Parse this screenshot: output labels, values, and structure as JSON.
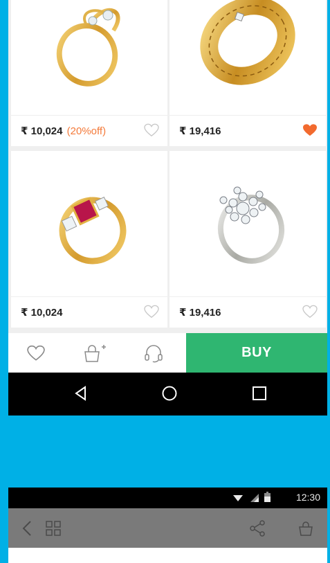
{
  "products": [
    {
      "price": "₹ 10,024",
      "discount": "(20%off)",
      "favorited": false,
      "image": "gold-twisted-diamond-ring"
    },
    {
      "price": "₹ 19,416",
      "discount": "",
      "favorited": true,
      "image": "gold-filigree-band"
    },
    {
      "price": "₹ 10,024",
      "discount": "",
      "favorited": false,
      "image": "gold-ruby-diamond-ring"
    },
    {
      "price": "₹ 19,416",
      "discount": "",
      "favorited": false,
      "image": "silver-diamond-flower-ring"
    }
  ],
  "action_bar": {
    "buy_label": "BUY",
    "icons": [
      "heart-outline-icon",
      "add-to-bag-icon",
      "support-headset-icon"
    ]
  },
  "system_nav": {
    "icons": [
      "back-triangle-icon",
      "home-circle-icon",
      "recents-square-icon"
    ]
  },
  "status_bar": {
    "time": "12:30"
  },
  "app_bar": {
    "icons": [
      "back-chevron-icon",
      "grid-icon",
      "share-icon",
      "bag-icon"
    ]
  },
  "colors": {
    "background": "#00b0e6",
    "buy": "#2fb671",
    "favorite": "#f26a2e",
    "discount": "#f47a3a"
  }
}
